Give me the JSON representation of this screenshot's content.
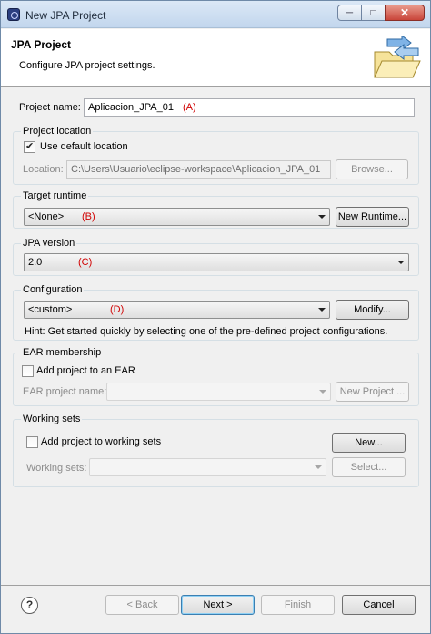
{
  "window": {
    "title": "New JPA Project",
    "minimize_glyph": "─",
    "maximize_glyph": "□",
    "close_glyph": "✕"
  },
  "header": {
    "title": "JPA Project",
    "description": "Configure JPA project settings.",
    "icon": "new-project-wizard-icon"
  },
  "project_name": {
    "label": "Project name:",
    "value": "Aplicacion_JPA_01",
    "annotation": "(A)"
  },
  "project_location": {
    "group_title": "Project location",
    "use_default_label": "Use default location",
    "use_default_checked": true,
    "location_label": "Location:",
    "location_value": "C:\\Users\\Usuario\\eclipse-workspace\\Aplicacion_JPA_01",
    "browse_label": "Browse..."
  },
  "target_runtime": {
    "group_title": "Target runtime",
    "selected": "<None>",
    "annotation": "(B)",
    "new_runtime_label": "New Runtime..."
  },
  "jpa_version": {
    "group_title": "JPA version",
    "selected": "2.0",
    "annotation": "(C)"
  },
  "configuration": {
    "group_title": "Configuration",
    "selected": "<custom>",
    "annotation": "(D)",
    "modify_label": "Modify...",
    "hint": "Hint: Get started quickly by selecting one of the pre-defined project configurations."
  },
  "ear_membership": {
    "group_title": "EAR membership",
    "add_label": "Add project to an EAR",
    "add_checked": false,
    "ear_project_name_label": "EAR project name:",
    "ear_project_name_value": "",
    "new_project_label": "New Project ..."
  },
  "working_sets": {
    "group_title": "Working sets",
    "add_label": "Add project to working sets",
    "add_checked": false,
    "new_label": "New...",
    "working_sets_label": "Working sets:",
    "working_sets_value": "",
    "select_label": "Select..."
  },
  "footer": {
    "help_glyph": "?",
    "back_label": "< Back",
    "next_label": "Next >",
    "finish_label": "Finish",
    "cancel_label": "Cancel"
  }
}
